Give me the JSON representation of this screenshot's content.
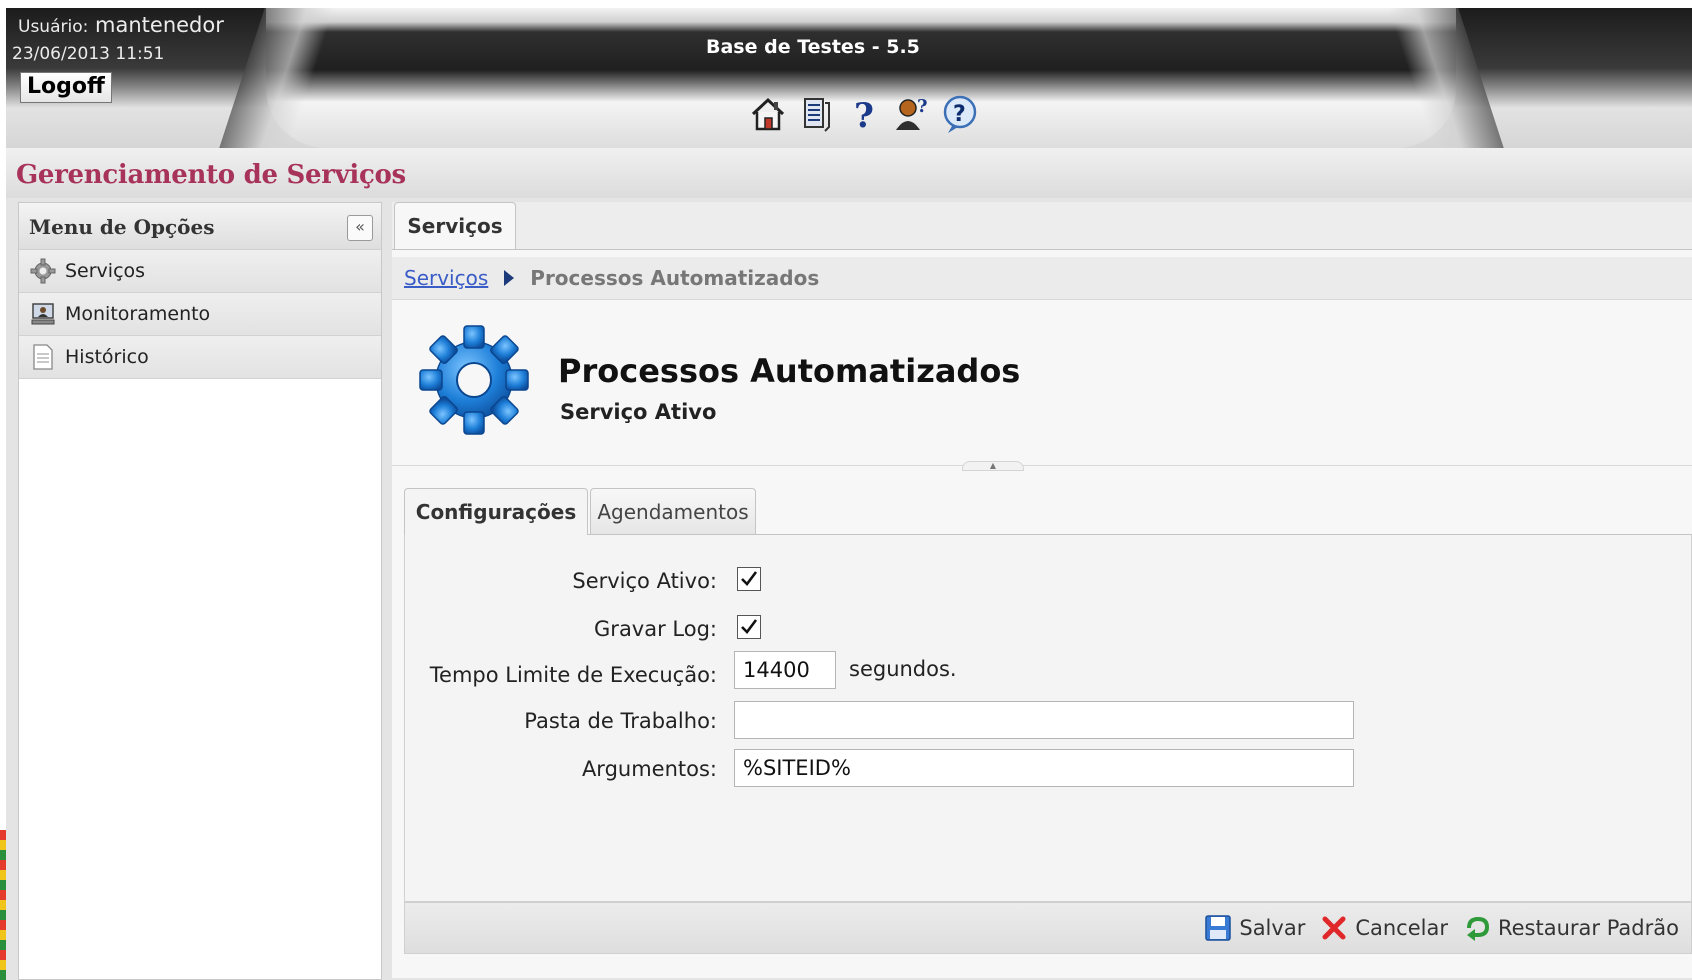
{
  "header": {
    "user_label": "Usuário:",
    "user_name": "mantenedor",
    "datetime": "23/06/2013 11:51",
    "logoff_label": "Logoff",
    "app_title": "Base de Testes - 5.5",
    "toolbar_icons": [
      "home-icon",
      "document-list-icon",
      "help-question-icon",
      "user-help-icon",
      "support-help-icon"
    ]
  },
  "page": {
    "title": "Gerenciamento de Serviços"
  },
  "sidebar": {
    "title": "Menu de Opções",
    "collapse_glyph": "«",
    "items": [
      {
        "label": "Serviços",
        "icon": "gear-icon"
      },
      {
        "label": "Monitoramento",
        "icon": "monitor-icon"
      },
      {
        "label": "Histórico",
        "icon": "document-icon"
      }
    ]
  },
  "main": {
    "top_tab": "Serviços",
    "breadcrumb": {
      "link": "Serviços",
      "current": "Processos Automatizados"
    },
    "service": {
      "name": "Processos Automatizados",
      "status": "Serviço Ativo"
    },
    "tabs": [
      "Configurações",
      "Agendamentos"
    ],
    "form": {
      "active_label": "Serviço Ativo:",
      "active_checked": true,
      "log_label": "Gravar Log:",
      "log_checked": true,
      "timeout_label": "Tempo Limite de Execução:",
      "timeout_value": "14400",
      "timeout_unit": "segundos.",
      "workdir_label": "Pasta de Trabalho:",
      "workdir_value": "",
      "args_label": "Argumentos:",
      "args_value": "%SITEID%"
    },
    "actions": {
      "save": "Salvar",
      "cancel": "Cancelar",
      "restore": "Restaurar Padrão"
    }
  },
  "colors": {
    "title_accent": "#a8335a",
    "link": "#3a5cc6",
    "gear_blue": "#1e7fd8"
  }
}
